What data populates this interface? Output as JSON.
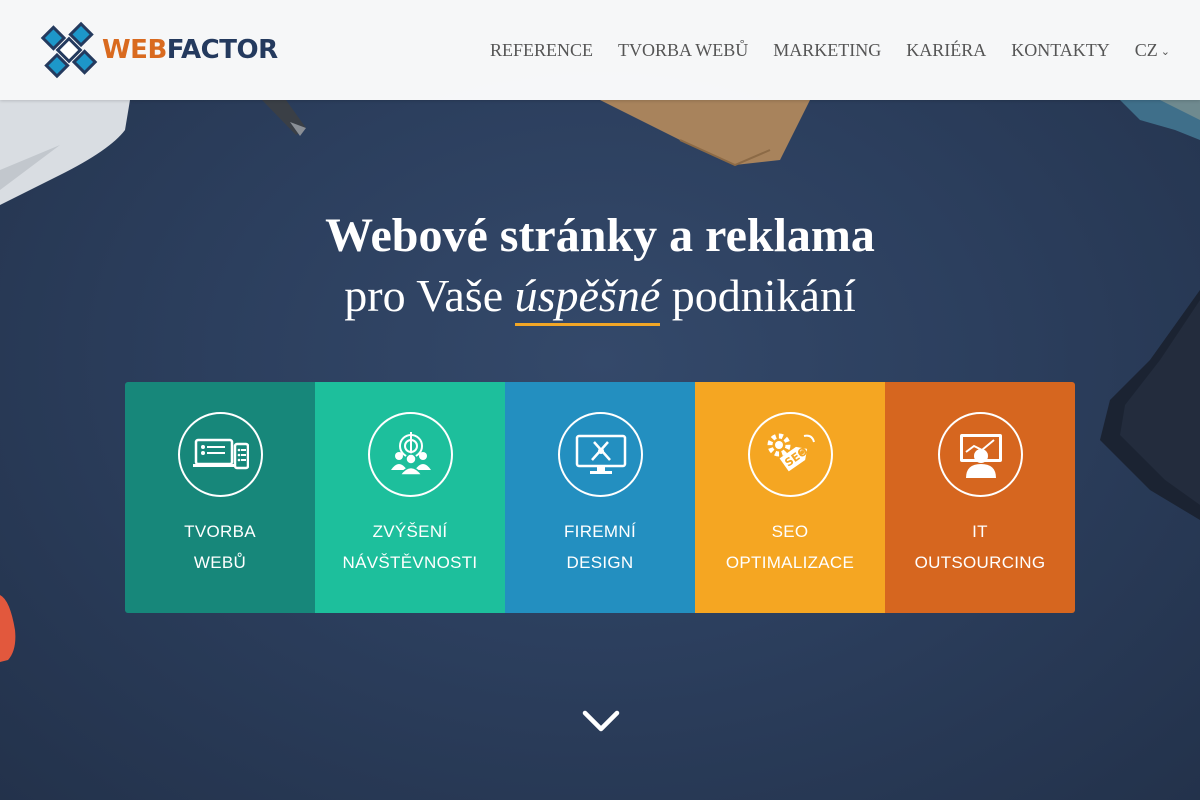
{
  "brand": {
    "part1": "WEB",
    "part2": "FACTOR",
    "color1": "#d96a1f",
    "color2": "#243a5e"
  },
  "nav": {
    "items": [
      "REFERENCE",
      "TVORBA WEBŮ",
      "MARKETING",
      "KARIÉRA",
      "KONTAKTY"
    ],
    "lang": "CZ"
  },
  "headline": {
    "line1": "Webové stránky a reklama",
    "line2_pre": "pro Vaše ",
    "line2_em": "úspěšné",
    "line2_post": " podnikání"
  },
  "tiles": [
    {
      "line1": "TVORBA",
      "line2": "WEBŮ",
      "color": "#17877a",
      "icon": "devices-icon"
    },
    {
      "line1": "ZVÝŠENÍ",
      "line2": "NÁVŠTĚVNOSTI",
      "color": "#1dbf9c",
      "icon": "audience-target-icon"
    },
    {
      "line1": "FIREMNÍ",
      "line2": "DESIGN",
      "color": "#238fc0",
      "icon": "design-monitor-icon"
    },
    {
      "line1": "SEO",
      "line2": "OPTIMALIZACE",
      "color": "#f5a622",
      "icon": "seo-tag-icon"
    },
    {
      "line1": "IT",
      "line2": "OUTSOURCING",
      "color": "#d6661f",
      "icon": "it-person-monitor-icon"
    }
  ],
  "accent": "#f2a626"
}
